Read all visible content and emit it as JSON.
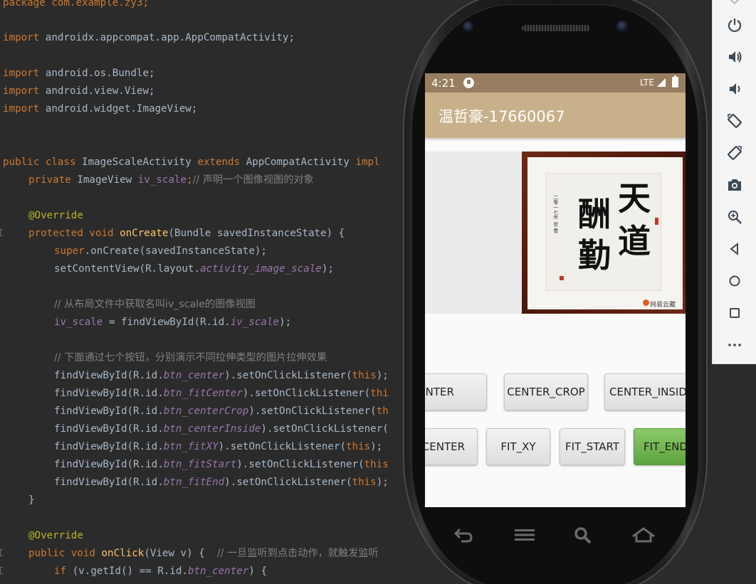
{
  "editor": {
    "lines": {
      "l0": [
        "package com.example.zy3;"
      ],
      "l2": [
        "import",
        " androidx.appcompat.app.AppCompatActivity;"
      ],
      "l4": [
        "import",
        " android.os.Bundle;"
      ],
      "l5": [
        "import",
        " android.view.View;"
      ],
      "l6": [
        "import",
        " android.widget.ImageView;"
      ],
      "l9": [
        "public class",
        " ImageScaleActivity ",
        "extends",
        " AppCompatActivity ",
        "impl"
      ],
      "l10": [
        "private",
        " ImageView ",
        "iv_scale",
        ";",
        "// 声明一个图像视图的对象"
      ],
      "l12": [
        "@Override"
      ],
      "l13": [
        "protected void",
        " ",
        "onCreate",
        "(Bundle savedInstanceState) {"
      ],
      "l14": [
        "super",
        ".onCreate(savedInstanceState);"
      ],
      "l15": [
        "setContentView(R.layout.",
        "activity_image_scale",
        ");"
      ],
      "l17": [
        "// 从布局文件中获取名叫iv_scale的图像视图"
      ],
      "l18": [
        "iv_scale",
        " = findViewById(R.id.",
        "iv_scale",
        ");"
      ],
      "l20": [
        "// 下面通过七个按钮，分别演示不同拉伸类型的图片拉伸效果"
      ],
      "l21": [
        "findViewById(R.id.",
        "btn_center",
        ").setOnClickListener(",
        "this",
        ");"
      ],
      "l22": [
        "findViewById(R.id.",
        "btn_fitCenter",
        ").setOnClickListener(",
        "thi"
      ],
      "l23": [
        "findViewById(R.id.",
        "btn_centerCrop",
        ").setOnClickListener(",
        "th"
      ],
      "l24": [
        "findViewById(R.id.",
        "btn_centerInside",
        ").setOnClickListener("
      ],
      "l25": [
        "findViewById(R.id.",
        "btn_fitXY",
        ").setOnClickListener(",
        "this",
        ");"
      ],
      "l26": [
        "findViewById(R.id.",
        "btn_fitStart",
        ").setOnClickListener(",
        "this"
      ],
      "l27": [
        "findViewById(R.id.",
        "btn_fitEnd",
        ").setOnClickListener(",
        "this",
        ");"
      ],
      "l28": [
        "}"
      ],
      "l30": [
        "@Override"
      ],
      "l31": [
        "public void",
        " ",
        "onClick",
        "(View v) {  ",
        "// 一旦监听到点击动作，就触发监听"
      ],
      "l32": [
        "if",
        " (v.getId() == R.id.",
        "btn_center",
        ") {"
      ]
    }
  },
  "phone": {
    "status": {
      "time": "4:21",
      "network": "LTE"
    },
    "app_title": "温哲豪-17660067",
    "calligraphy": {
      "right_col": [
        "天",
        "道"
      ],
      "left_col": [
        "酬",
        "勤"
      ],
      "inscription": "二零一七年 张 書"
    },
    "watermark": "网易云藏",
    "buttons_row1": [
      "FIT_CENTER",
      "CENTER_CROP",
      "CENTER_INSIDE"
    ],
    "buttons_row2": [
      "CENTER",
      "FIT_XY",
      "FIT_START",
      "FIT_END"
    ],
    "hw_nav": [
      "back-icon",
      "menu-icon",
      "search-icon",
      "home-icon"
    ]
  },
  "toolbar": {
    "icons": [
      "power-icon",
      "volume-up-icon",
      "volume-down-icon",
      "rotate-left-icon",
      "rotate-right-icon",
      "camera-icon",
      "zoom-icon",
      "back-icon",
      "home-icon",
      "overview-icon",
      "more-icon"
    ]
  }
}
